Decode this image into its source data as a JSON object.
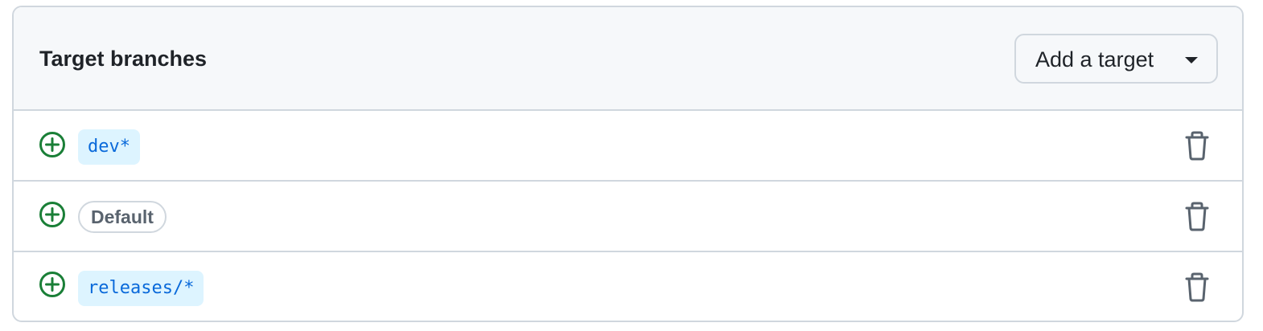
{
  "header": {
    "title": "Target branches",
    "add_target_label": "Add a target"
  },
  "targets": [
    {
      "label": "dev*",
      "style": "code",
      "icon": "plus-circle-icon",
      "action_icon": "trash-icon"
    },
    {
      "label": "Default",
      "style": "pill",
      "icon": "plus-circle-icon",
      "action_icon": "trash-icon"
    },
    {
      "label": "releases/*",
      "style": "code",
      "icon": "plus-circle-icon",
      "action_icon": "trash-icon"
    }
  ],
  "colors": {
    "header_bg": "#f6f8fa",
    "border": "#d0d7de",
    "text": "#1f2328",
    "include_green": "#1a7f37",
    "code_chip_bg": "#ddf4ff",
    "code_chip_text": "#0969da",
    "pill_text": "#59636e",
    "icon_gray": "#59636e"
  }
}
